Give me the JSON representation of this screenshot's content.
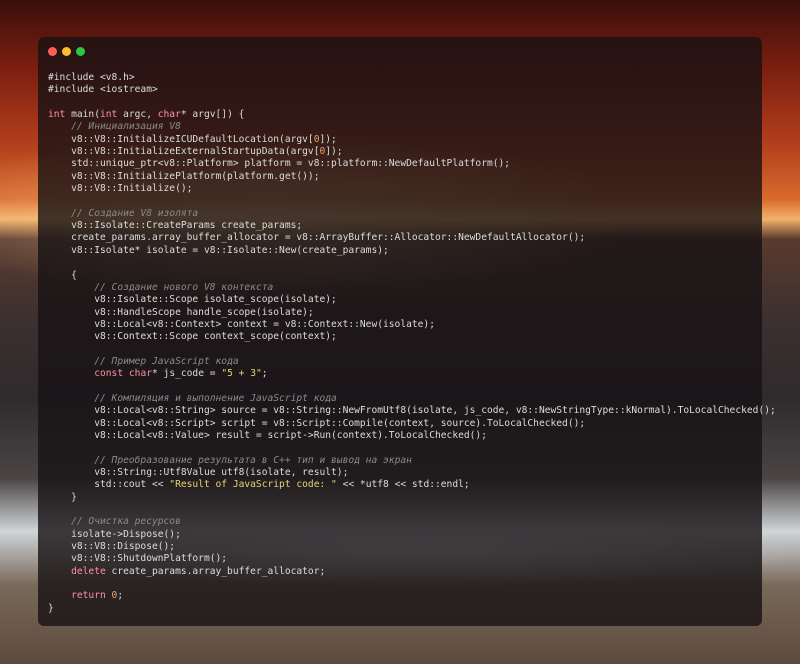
{
  "window": {
    "controls": [
      "close",
      "minimize",
      "maximize"
    ],
    "colors": {
      "close": "#ff5f57",
      "minimize": "#febc2e",
      "maximize": "#28c840"
    }
  },
  "code_lines": [
    "#include <v8.h>",
    "#include <iostream>",
    "",
    "int main(int argc, char* argv[]) {",
    "    // Инициализация V8",
    "    v8::V8::InitializeICUDefaultLocation(argv[0]);",
    "    v8::V8::InitializeExternalStartupData(argv[0]);",
    "    std::unique_ptr<v8::Platform> platform = v8::platform::NewDefaultPlatform();",
    "    v8::V8::InitializePlatform(platform.get());",
    "    v8::V8::Initialize();",
    "",
    "    // Создание V8 изолята",
    "    v8::Isolate::CreateParams create_params;",
    "    create_params.array_buffer_allocator = v8::ArrayBuffer::Allocator::NewDefaultAllocator();",
    "    v8::Isolate* isolate = v8::Isolate::New(create_params);",
    "",
    "    {",
    "        // Создание нового V8 контекста",
    "        v8::Isolate::Scope isolate_scope(isolate);",
    "        v8::HandleScope handle_scope(isolate);",
    "        v8::Local<v8::Context> context = v8::Context::New(isolate);",
    "        v8::Context::Scope context_scope(context);",
    "",
    "        // Пример JavaScript кода",
    "        const char* js_code = \"5 + 3\";",
    "",
    "        // Компиляция и выполнение JavaScript кода",
    "        v8::Local<v8::String> source = v8::String::NewFromUtf8(isolate, js_code, v8::NewStringType::kNormal).ToLocalChecked();",
    "        v8::Local<v8::Script> script = v8::Script::Compile(context, source).ToLocalChecked();",
    "        v8::Local<v8::Value> result = script->Run(context).ToLocalChecked();",
    "",
    "        // Преобразование результата в C++ тип и вывод на экран",
    "        v8::String::Utf8Value utf8(isolate, result);",
    "        std::cout << \"Result of JavaScript code: \" << *utf8 << std::endl;",
    "    }",
    "",
    "    // Очистка ресурсов",
    "    isolate->Dispose();",
    "    v8::V8::Dispose();",
    "    v8::V8::ShutdownPlatform();",
    "    delete create_params.array_buffer_allocator;",
    "",
    "    return 0;",
    "}"
  ]
}
